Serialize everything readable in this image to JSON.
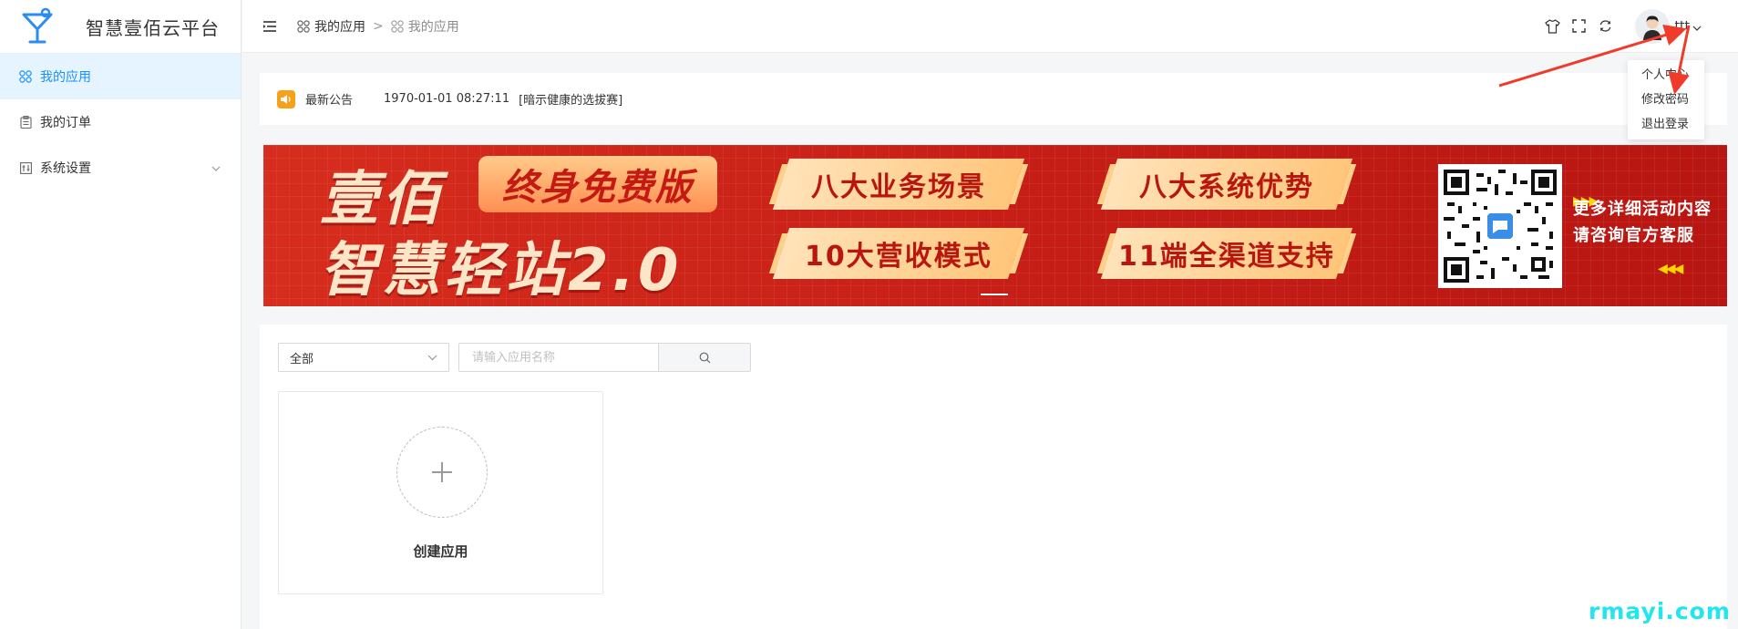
{
  "brand": {
    "name": "智慧壹佰云平台",
    "icon": "cocktail-logo-icon",
    "color": "#2b8cf2"
  },
  "sidebar": {
    "items": [
      {
        "label": "我的应用",
        "icon": "apps-icon",
        "active": true
      },
      {
        "label": "我的订单",
        "icon": "clipboard-icon",
        "active": false
      },
      {
        "label": "系统设置",
        "icon": "settings-panel-icon",
        "active": false,
        "expandable": true
      }
    ]
  },
  "header": {
    "breadcrumb": [
      "我的应用",
      "我的应用"
    ],
    "breadcrumb_separator": ">",
    "icons": [
      "shirt-theme-icon",
      "fullscreen-icon",
      "refresh-icon"
    ],
    "user_name": "ttt"
  },
  "user_menu": {
    "items": [
      "个人中心",
      "修改密码",
      "退出登录"
    ]
  },
  "notice": {
    "label": "最新公告",
    "date": "1970-01-01 08:27:11",
    "text": "[暗示健康的选拔赛]"
  },
  "banner": {
    "title_line1": "壹佰",
    "badge": "终身免费版",
    "title_line2": "智慧轻站2.0",
    "pills": [
      "八大业务场景",
      "八大系统优势",
      "10大营收模式",
      "11端全渠道支持"
    ],
    "more_line1": "更多详细活动内容",
    "more_line2": "请咨询官方客服",
    "colors": {
      "background": "#c71f17",
      "text": "#fde5c8",
      "pill_text": "#b8160f"
    }
  },
  "apps": {
    "filter_value": "全部",
    "search_placeholder": "请输入应用名称",
    "create_label": "创建应用"
  },
  "watermark": "rmayi.com",
  "colors": {
    "accent": "#1890ff",
    "active_bg": "#e6f4ff",
    "annotation": "#f03a2a"
  }
}
